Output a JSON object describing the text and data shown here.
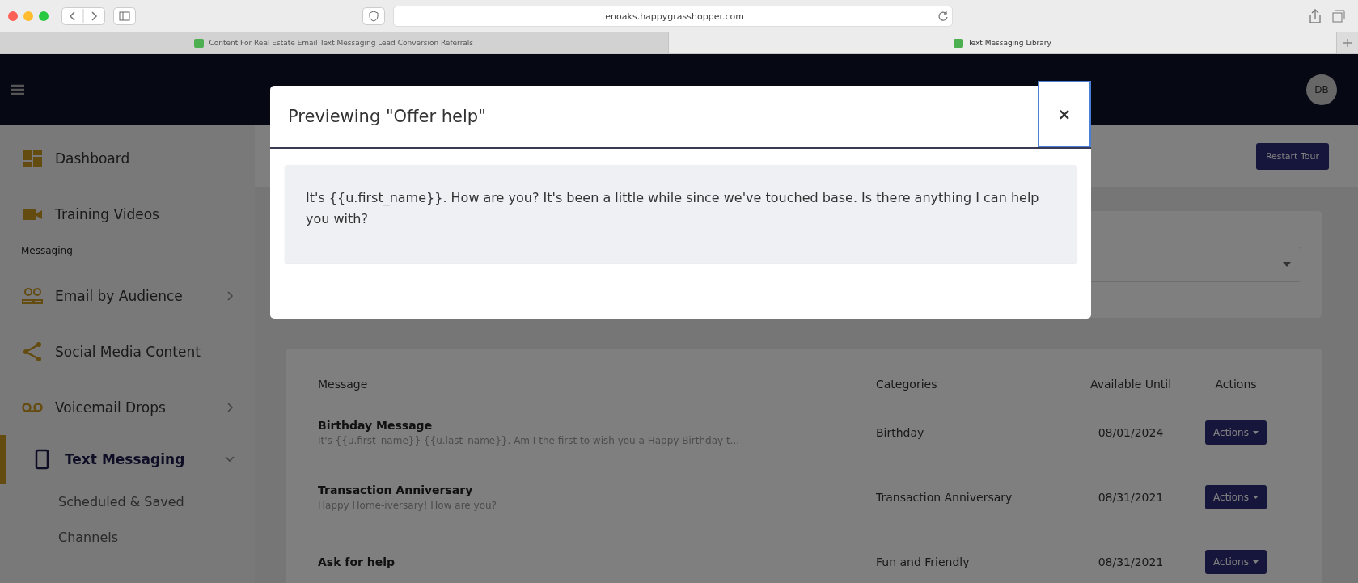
{
  "browser": {
    "url": "tenoaks.happygrasshopper.com",
    "tabs": [
      {
        "label": "Content For Real Estate Email Text Messaging Lead Conversion Referrals",
        "selected": false
      },
      {
        "label": "Text Messaging Library",
        "selected": true
      }
    ]
  },
  "header": {
    "avatar": "DB"
  },
  "sidebar": {
    "items": [
      {
        "kind": "item",
        "label": "Dashboard",
        "selected": false
      },
      {
        "kind": "item",
        "label": "Training Videos",
        "selected": false
      },
      {
        "kind": "heading",
        "label": "Messaging"
      },
      {
        "kind": "item",
        "label": "Email by Audience",
        "selected": false,
        "expanded": false
      },
      {
        "kind": "item",
        "label": "Social Media Content",
        "selected": false
      },
      {
        "kind": "item",
        "label": "Voicemail Drops",
        "selected": false,
        "expanded": false
      },
      {
        "kind": "item",
        "label": "Text Messaging",
        "selected": true,
        "expanded": true
      },
      {
        "kind": "subitem",
        "label": "Scheduled & Saved"
      },
      {
        "kind": "subitem",
        "label": "Channels"
      }
    ]
  },
  "toolbar": {
    "button": "Restart Tour"
  },
  "table": {
    "columns": [
      "Message",
      "Categories",
      "Available Until",
      "Actions"
    ],
    "rows": [
      {
        "title": "Birthday Message",
        "preview": "It's {{u.first_name}} {{u.last_name}}. Am I the first to wish you a Happy Birthday t...",
        "category": "Birthday",
        "date": "08/01/2024",
        "action": "Actions"
      },
      {
        "title": "Transaction Anniversary",
        "preview": "Happy Home-iversary! How are you?",
        "category": "Transaction Anniversary",
        "date": "08/31/2021",
        "action": "Actions"
      },
      {
        "title": "Ask for help",
        "category": "Fun and Friendly",
        "date": "08/31/2021",
        "action": "Actions"
      }
    ]
  },
  "modal": {
    "title": "Previewing \"Offer help\"",
    "close": "×",
    "message": "It's {{u.first_name}}. How are you? It's been a little while since we've touched base. Is there anything I can help you with?"
  }
}
